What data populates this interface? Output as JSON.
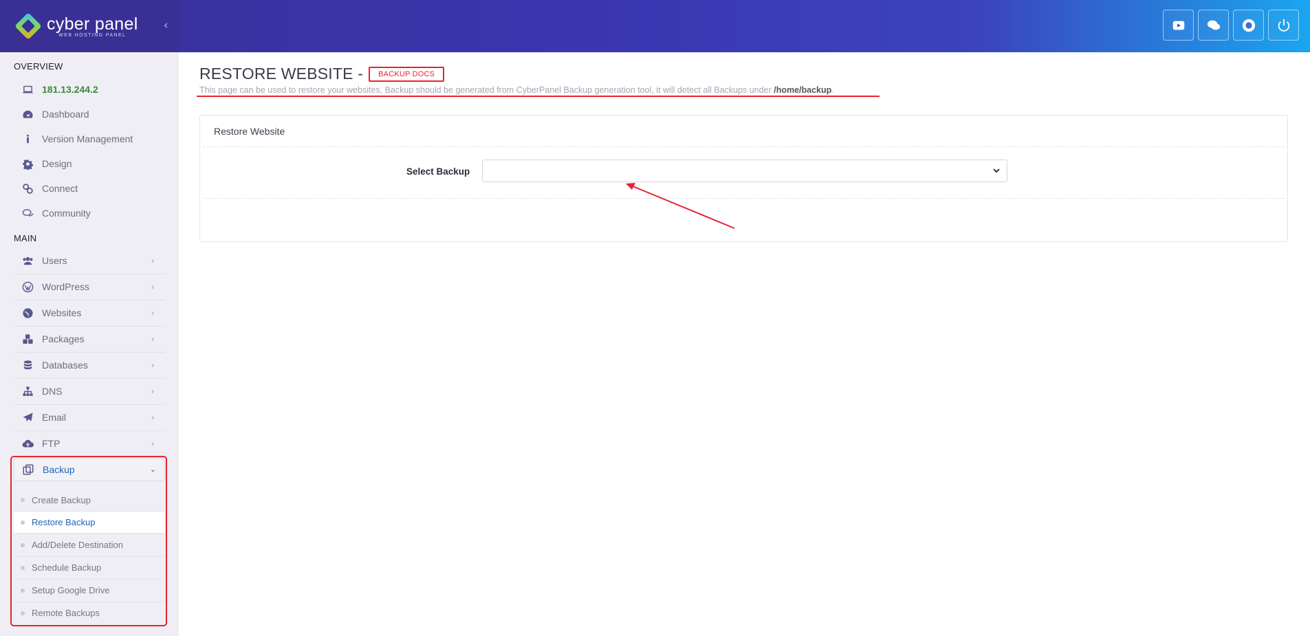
{
  "brand": {
    "name": "cyber panel",
    "tagline": "WEB HOSTING PANEL"
  },
  "top_actions": [
    {
      "icon": "youtube-icon"
    },
    {
      "icon": "chat-icon"
    },
    {
      "icon": "lifebuoy-icon"
    },
    {
      "icon": "power-icon"
    }
  ],
  "sidebar": {
    "overview_heading": "OVERVIEW",
    "ip": "181.13.244.2",
    "overview_items": [
      "Dashboard",
      "Version Management",
      "Design",
      "Connect",
      "Community"
    ],
    "main_heading": "MAIN",
    "main_items": [
      "Users",
      "WordPress",
      "Websites",
      "Packages",
      "Databases",
      "DNS",
      "Email",
      "FTP"
    ],
    "backup_label": "Backup",
    "backup_sub": [
      "Create Backup",
      "Restore Backup",
      "Add/Delete Destination",
      "Schedule Backup",
      "Setup Google Drive",
      "Remote Backups"
    ]
  },
  "main": {
    "title": "RESTORE WEBSITE -",
    "docs_button": "BACKUP DOCS",
    "description": "This page can be used to restore your websites, Backup should be generated from CyberPanel Backup generation tool, it will detect all Backups under",
    "description_path": "/home/backup",
    "description_end": ".",
    "card_title": "Restore Website",
    "select_label": "Select Backup",
    "select_value": ""
  },
  "colors": {
    "accent": "#3a2f95",
    "highlight": "#e8222f",
    "link": "#1f64b8",
    "ip": "#3b8a3c"
  }
}
